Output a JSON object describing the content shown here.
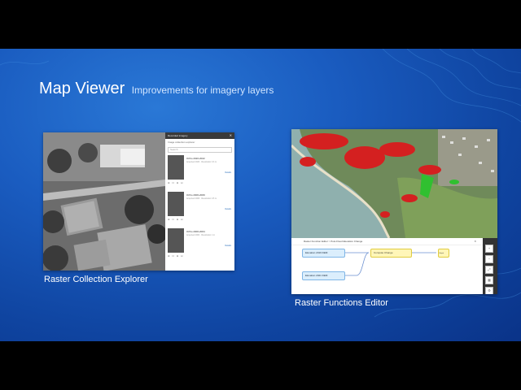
{
  "slide": {
    "title": "Map Viewer",
    "subtitle": "Improvements for imagery layers"
  },
  "left_screenshot": {
    "caption": "Raster Collection Explorer",
    "panel": {
      "title": "Recorded imagery",
      "subtitle": "Image collection explorer",
      "search_placeholder": "Search",
      "tabs": [
        "All",
        "Filter"
      ],
      "items": [
        {
          "name": "Ortho 2020-2022",
          "meta": "Acquired 2020 · Resolution 0.3 m",
          "action": "Details"
        },
        {
          "name": "Ortho 2006-2009",
          "meta": "Acquired 2006 · Resolution 0.5 m",
          "action": "Details"
        },
        {
          "name": "Ortho 2000-2004",
          "meta": "Acquired 2000 · Resolution 1 m",
          "action": "Details"
        }
      ]
    }
  },
  "right_screenshot": {
    "caption": "Raster Functions Editor",
    "editor": {
      "title": "Raster Function Editor > Post-Flood Elevation Change",
      "nodes": {
        "input1": "Elevation 2019 DEM",
        "input2": "Elevation 2021 DEM",
        "function": "Compute Change",
        "output": "Output"
      }
    }
  }
}
